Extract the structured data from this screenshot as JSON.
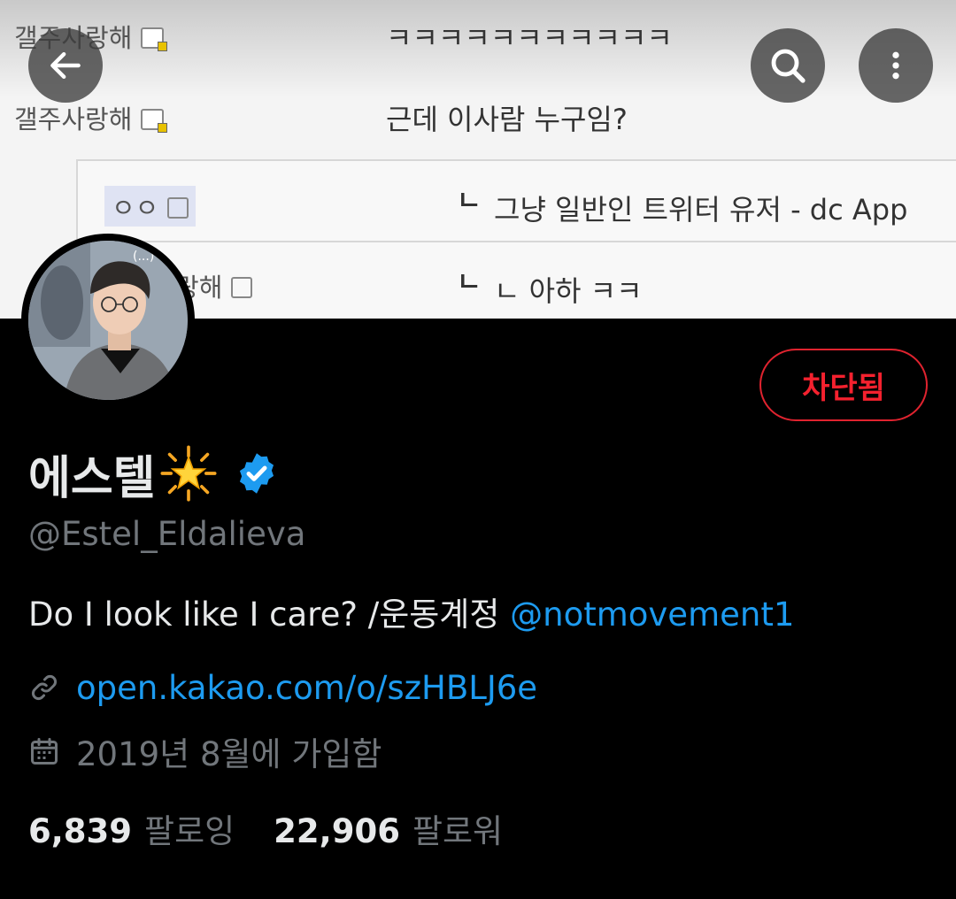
{
  "banner": {
    "rows": [
      {
        "nickname": "갤주사랑해",
        "message": "ㅋㅋㅋㅋㅋㅋㅋㅋㅋㅋㅋ"
      },
      {
        "nickname": "갤주사랑해",
        "message": "근데 이사람 누구임?"
      }
    ],
    "replies": [
      {
        "nickname": "ㅇㅇ",
        "marker": "ㄴ",
        "message": "그냥 일반인 트위터 유저 - dc App"
      },
      {
        "nickname": "갤주사랑해",
        "marker": "ㄴ",
        "message": "ㄴ 아하 ㅋㅋ"
      }
    ]
  },
  "header": {
    "back_icon": "arrow-left-icon",
    "search_icon": "search-icon",
    "more_icon": "more-vertical-icon"
  },
  "profile": {
    "display_name": "에스텔",
    "name_emoji": "glowing-star-emoji",
    "verified_icon": "verified-badge-icon",
    "handle": "@Estel_Eldalieva",
    "bio_text": "Do I look like I care? /운동계정 ",
    "bio_mention": "@notmovement1",
    "link": "open.kakao.com/o/szHBLJ6e",
    "joined": "2019년 8월에 가입함",
    "blocked_label": "차단됨",
    "following_count": "6,839",
    "following_label": "팔로잉",
    "followers_count": "22,906",
    "followers_label": "팔로워"
  },
  "colors": {
    "background": "#000000",
    "accent_blue": "#1d9bf0",
    "blocked_red": "#f4212e",
    "muted_text": "#71767b",
    "primary_text": "#e7e9ea"
  }
}
